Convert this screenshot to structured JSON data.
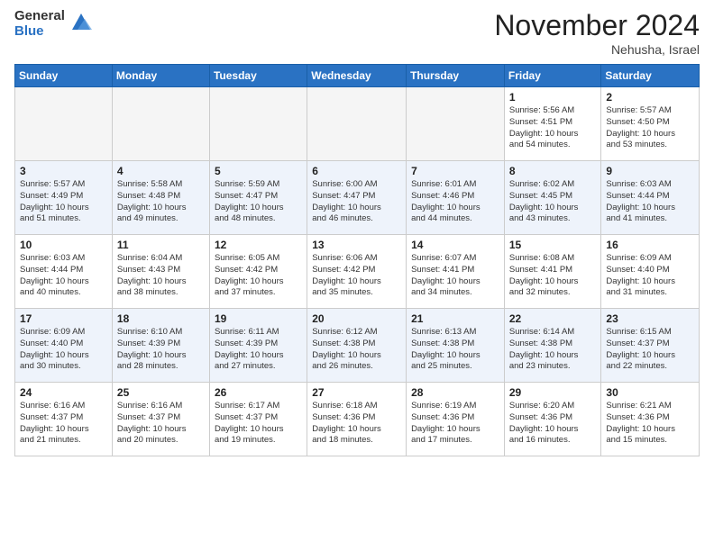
{
  "header": {
    "logo_general": "General",
    "logo_blue": "Blue",
    "month_title": "November 2024",
    "location": "Nehusha, Israel"
  },
  "weekdays": [
    "Sunday",
    "Monday",
    "Tuesday",
    "Wednesday",
    "Thursday",
    "Friday",
    "Saturday"
  ],
  "weeks": [
    [
      {
        "day": "",
        "info": ""
      },
      {
        "day": "",
        "info": ""
      },
      {
        "day": "",
        "info": ""
      },
      {
        "day": "",
        "info": ""
      },
      {
        "day": "",
        "info": ""
      },
      {
        "day": "1",
        "info": "Sunrise: 5:56 AM\nSunset: 4:51 PM\nDaylight: 10 hours\nand 54 minutes."
      },
      {
        "day": "2",
        "info": "Sunrise: 5:57 AM\nSunset: 4:50 PM\nDaylight: 10 hours\nand 53 minutes."
      }
    ],
    [
      {
        "day": "3",
        "info": "Sunrise: 5:57 AM\nSunset: 4:49 PM\nDaylight: 10 hours\nand 51 minutes."
      },
      {
        "day": "4",
        "info": "Sunrise: 5:58 AM\nSunset: 4:48 PM\nDaylight: 10 hours\nand 49 minutes."
      },
      {
        "day": "5",
        "info": "Sunrise: 5:59 AM\nSunset: 4:47 PM\nDaylight: 10 hours\nand 48 minutes."
      },
      {
        "day": "6",
        "info": "Sunrise: 6:00 AM\nSunset: 4:47 PM\nDaylight: 10 hours\nand 46 minutes."
      },
      {
        "day": "7",
        "info": "Sunrise: 6:01 AM\nSunset: 4:46 PM\nDaylight: 10 hours\nand 44 minutes."
      },
      {
        "day": "8",
        "info": "Sunrise: 6:02 AM\nSunset: 4:45 PM\nDaylight: 10 hours\nand 43 minutes."
      },
      {
        "day": "9",
        "info": "Sunrise: 6:03 AM\nSunset: 4:44 PM\nDaylight: 10 hours\nand 41 minutes."
      }
    ],
    [
      {
        "day": "10",
        "info": "Sunrise: 6:03 AM\nSunset: 4:44 PM\nDaylight: 10 hours\nand 40 minutes."
      },
      {
        "day": "11",
        "info": "Sunrise: 6:04 AM\nSunset: 4:43 PM\nDaylight: 10 hours\nand 38 minutes."
      },
      {
        "day": "12",
        "info": "Sunrise: 6:05 AM\nSunset: 4:42 PM\nDaylight: 10 hours\nand 37 minutes."
      },
      {
        "day": "13",
        "info": "Sunrise: 6:06 AM\nSunset: 4:42 PM\nDaylight: 10 hours\nand 35 minutes."
      },
      {
        "day": "14",
        "info": "Sunrise: 6:07 AM\nSunset: 4:41 PM\nDaylight: 10 hours\nand 34 minutes."
      },
      {
        "day": "15",
        "info": "Sunrise: 6:08 AM\nSunset: 4:41 PM\nDaylight: 10 hours\nand 32 minutes."
      },
      {
        "day": "16",
        "info": "Sunrise: 6:09 AM\nSunset: 4:40 PM\nDaylight: 10 hours\nand 31 minutes."
      }
    ],
    [
      {
        "day": "17",
        "info": "Sunrise: 6:09 AM\nSunset: 4:40 PM\nDaylight: 10 hours\nand 30 minutes."
      },
      {
        "day": "18",
        "info": "Sunrise: 6:10 AM\nSunset: 4:39 PM\nDaylight: 10 hours\nand 28 minutes."
      },
      {
        "day": "19",
        "info": "Sunrise: 6:11 AM\nSunset: 4:39 PM\nDaylight: 10 hours\nand 27 minutes."
      },
      {
        "day": "20",
        "info": "Sunrise: 6:12 AM\nSunset: 4:38 PM\nDaylight: 10 hours\nand 26 minutes."
      },
      {
        "day": "21",
        "info": "Sunrise: 6:13 AM\nSunset: 4:38 PM\nDaylight: 10 hours\nand 25 minutes."
      },
      {
        "day": "22",
        "info": "Sunrise: 6:14 AM\nSunset: 4:38 PM\nDaylight: 10 hours\nand 23 minutes."
      },
      {
        "day": "23",
        "info": "Sunrise: 6:15 AM\nSunset: 4:37 PM\nDaylight: 10 hours\nand 22 minutes."
      }
    ],
    [
      {
        "day": "24",
        "info": "Sunrise: 6:16 AM\nSunset: 4:37 PM\nDaylight: 10 hours\nand 21 minutes."
      },
      {
        "day": "25",
        "info": "Sunrise: 6:16 AM\nSunset: 4:37 PM\nDaylight: 10 hours\nand 20 minutes."
      },
      {
        "day": "26",
        "info": "Sunrise: 6:17 AM\nSunset: 4:37 PM\nDaylight: 10 hours\nand 19 minutes."
      },
      {
        "day": "27",
        "info": "Sunrise: 6:18 AM\nSunset: 4:36 PM\nDaylight: 10 hours\nand 18 minutes."
      },
      {
        "day": "28",
        "info": "Sunrise: 6:19 AM\nSunset: 4:36 PM\nDaylight: 10 hours\nand 17 minutes."
      },
      {
        "day": "29",
        "info": "Sunrise: 6:20 AM\nSunset: 4:36 PM\nDaylight: 10 hours\nand 16 minutes."
      },
      {
        "day": "30",
        "info": "Sunrise: 6:21 AM\nSunset: 4:36 PM\nDaylight: 10 hours\nand 15 minutes."
      }
    ]
  ]
}
